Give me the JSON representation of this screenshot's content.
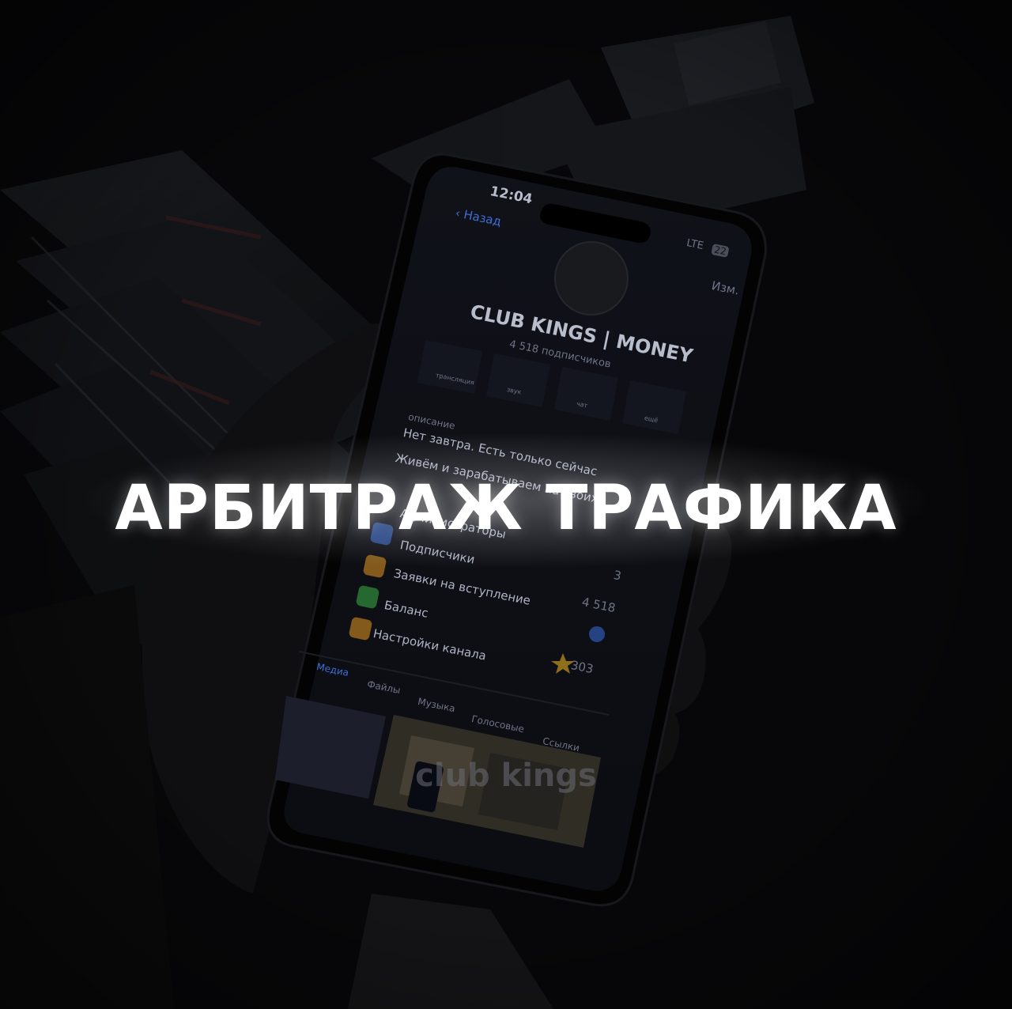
{
  "headline": "АРБИТРАЖ ТРАФИКА",
  "watermark": "club kings",
  "phone": {
    "status_time": "12:04",
    "network": "LTE",
    "battery": "22",
    "back_label": "Назад",
    "edit_label": "Изм.",
    "channel_title": "CLUB KINGS | MONEY",
    "subscribers_line": "4 518 подписчиков",
    "actions": [
      "трансляция",
      "звук",
      "чат",
      "ещё"
    ],
    "description_label": "описание",
    "description_line1": "Нет завтра. Есть только сейчас",
    "description_line2": "Живём и зарабатываем на своих",
    "menu": [
      {
        "label": "Администраторы",
        "value": ""
      },
      {
        "label": "Подписчики",
        "value": "3"
      },
      {
        "label": "Заявки на вступление",
        "value": "4 518"
      },
      {
        "label": "Баланс",
        "value": ""
      },
      {
        "label": "Настройки канала",
        "value": "303"
      }
    ],
    "tabs": [
      "Медиа",
      "Файлы",
      "Музыка",
      "Голосовые",
      "Ссылки"
    ]
  }
}
